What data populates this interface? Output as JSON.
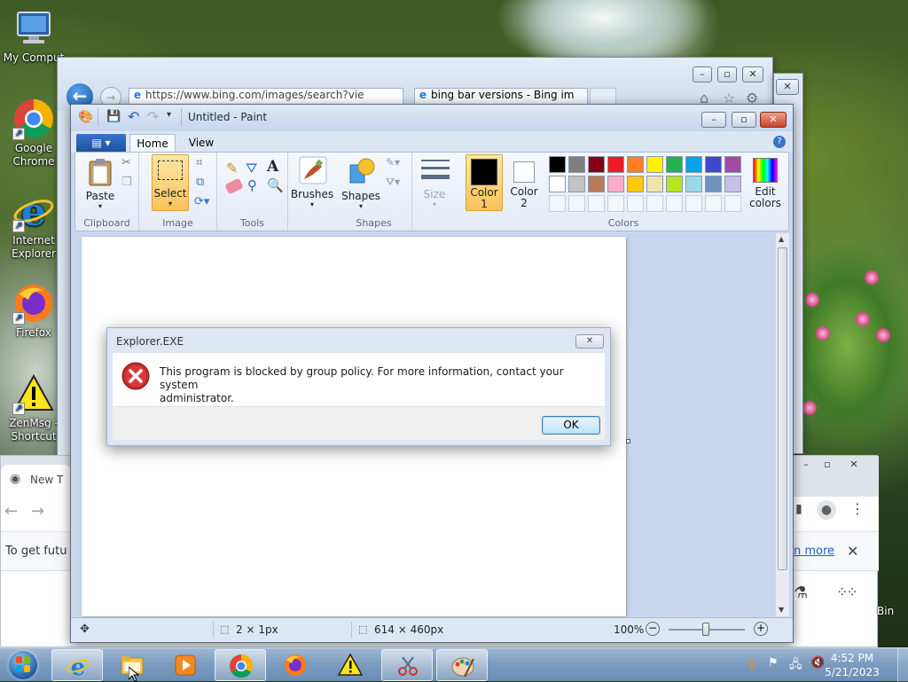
{
  "desktop": {
    "icons": [
      {
        "label": "My Comput",
        "icon": "computer-icon"
      },
      {
        "label": "Google Chrome",
        "icon": "chrome-icon"
      },
      {
        "label": "Internet Explorer",
        "icon": "ie-icon"
      },
      {
        "label": "Firefox",
        "icon": "firefox-icon"
      },
      {
        "label": "ZenMsg - Shortcut",
        "icon": "warning-icon"
      }
    ]
  },
  "ie_window": {
    "url": "https://www.bing.com/images/search?vie",
    "tab_title": "bing bar versions - Bing im"
  },
  "chrome_window": {
    "tab_label": "New T",
    "infobar_text": "To get futu",
    "learn_more": "n more",
    "bin_label": "Bin"
  },
  "paint": {
    "title": "Untitled - Paint",
    "tabs": {
      "home": "Home",
      "view": "View"
    },
    "groups": {
      "clipboard": "Clipboard",
      "image": "Image",
      "tools": "Tools",
      "shapes": "Shapes",
      "colors": "Colors"
    },
    "buttons": {
      "paste": "Paste",
      "select": "Select",
      "brushes": "Brushes",
      "shapes": "Shapes",
      "size": "Size",
      "color1": "Color 1",
      "color2": "Color 2",
      "edit_colors": "Edit colors"
    },
    "color1": "#000000",
    "color2": "#ffffff",
    "palette_row1": [
      "#000000",
      "#7f7f7f",
      "#880015",
      "#ed1c24",
      "#ff7f27",
      "#fff200",
      "#22b14c",
      "#00a2e8",
      "#3f48cc",
      "#a349a4"
    ],
    "palette_row2": [
      "#ffffff",
      "#c3c3c3",
      "#b97a57",
      "#ffaec9",
      "#ffc90e",
      "#efe4b0",
      "#b5e61d",
      "#99d9ea",
      "#7092be",
      "#c8bfe7"
    ],
    "status": {
      "selection_size": "2 × 1px",
      "canvas_size": "614 × 460px",
      "zoom": "100%"
    }
  },
  "dialog": {
    "title": "Explorer.EXE",
    "message_line1": "This program is blocked by group policy. For more information, contact your system",
    "message_line2": "administrator.",
    "ok_label": "OK"
  },
  "taskbar": {
    "time": "4:52 PM",
    "date": "5/21/2023"
  }
}
